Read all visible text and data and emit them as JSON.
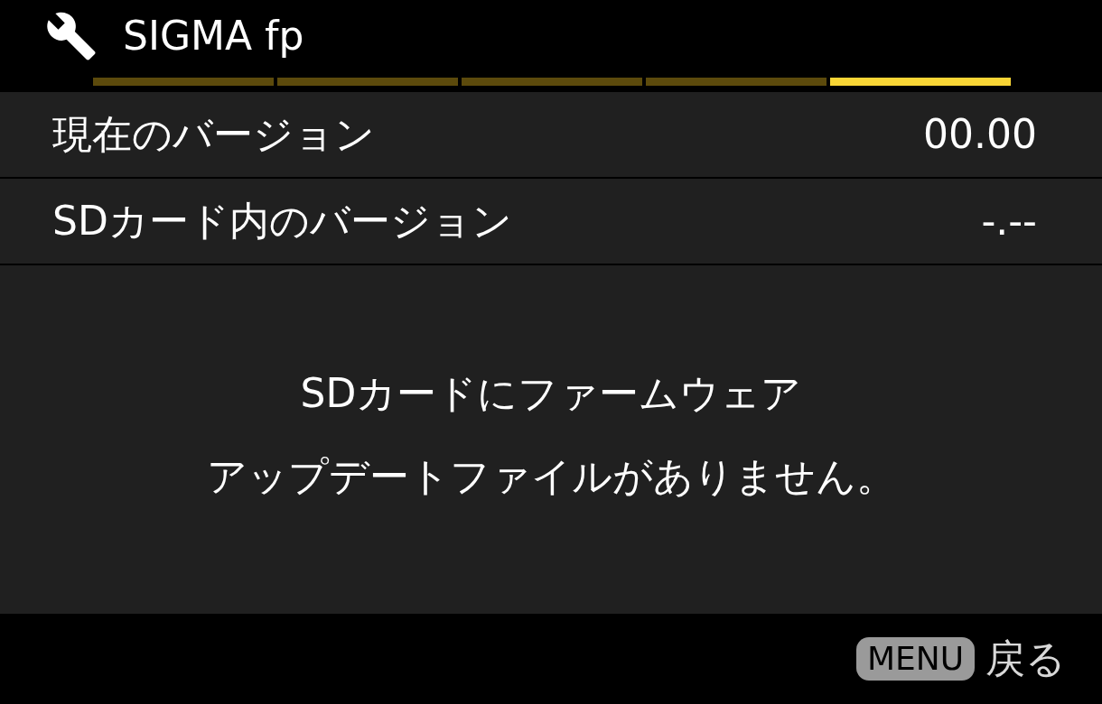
{
  "header": {
    "title": "SIGMA fp"
  },
  "pages": [
    {
      "selected": false
    },
    {
      "selected": false
    },
    {
      "selected": false
    },
    {
      "selected": false
    },
    {
      "selected": true
    }
  ],
  "rows": [
    {
      "label": "現在のバージョン",
      "value": "00.00"
    },
    {
      "label": "SDカード内のバージョン",
      "value": "-.--"
    }
  ],
  "message": [
    "SDカードにファームウェア",
    "アップデートファイルがありません。"
  ],
  "footer": {
    "key": "MENU",
    "action": "戻る"
  }
}
